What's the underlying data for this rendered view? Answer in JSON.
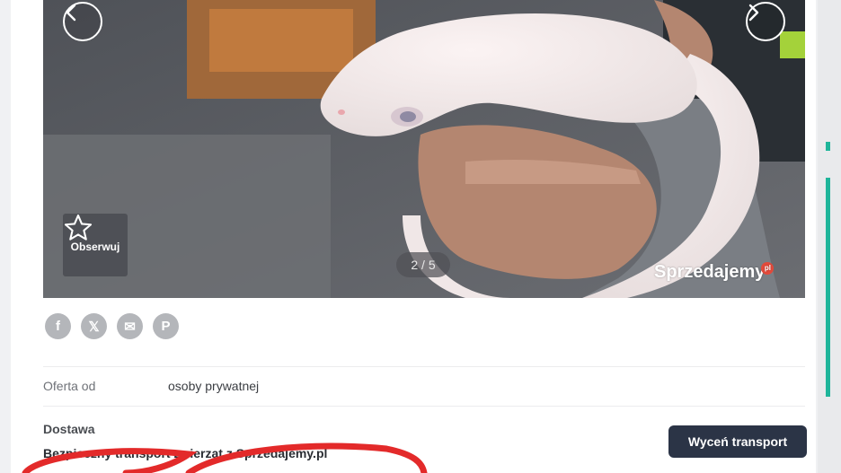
{
  "gallery": {
    "counter": "2 / 5",
    "follow_label": "Obserwuj",
    "watermark": "Sprzedajemy",
    "watermark_suffix": "pl",
    "prev_icon": "chevron-left-icon",
    "next_icon": "chevron-right-icon"
  },
  "share": [
    {
      "name": "facebook-icon",
      "glyph": "f"
    },
    {
      "name": "x-icon",
      "glyph": "𝕏"
    },
    {
      "name": "mail-icon",
      "glyph": "✉"
    },
    {
      "name": "pinterest-icon",
      "glyph": "P"
    }
  ],
  "details": {
    "offer_label": "Oferta od",
    "offer_value": "osoby prywatnej"
  },
  "delivery": {
    "title": "Dostawa",
    "transport_text": "Bezpieczny transport zwierząt z Sprzedajemy.pl",
    "quote_button": "Wyceń transport"
  },
  "colors": {
    "accent": "#1fb59a",
    "button": "#2b3446",
    "annotation": "#e32a2a"
  }
}
